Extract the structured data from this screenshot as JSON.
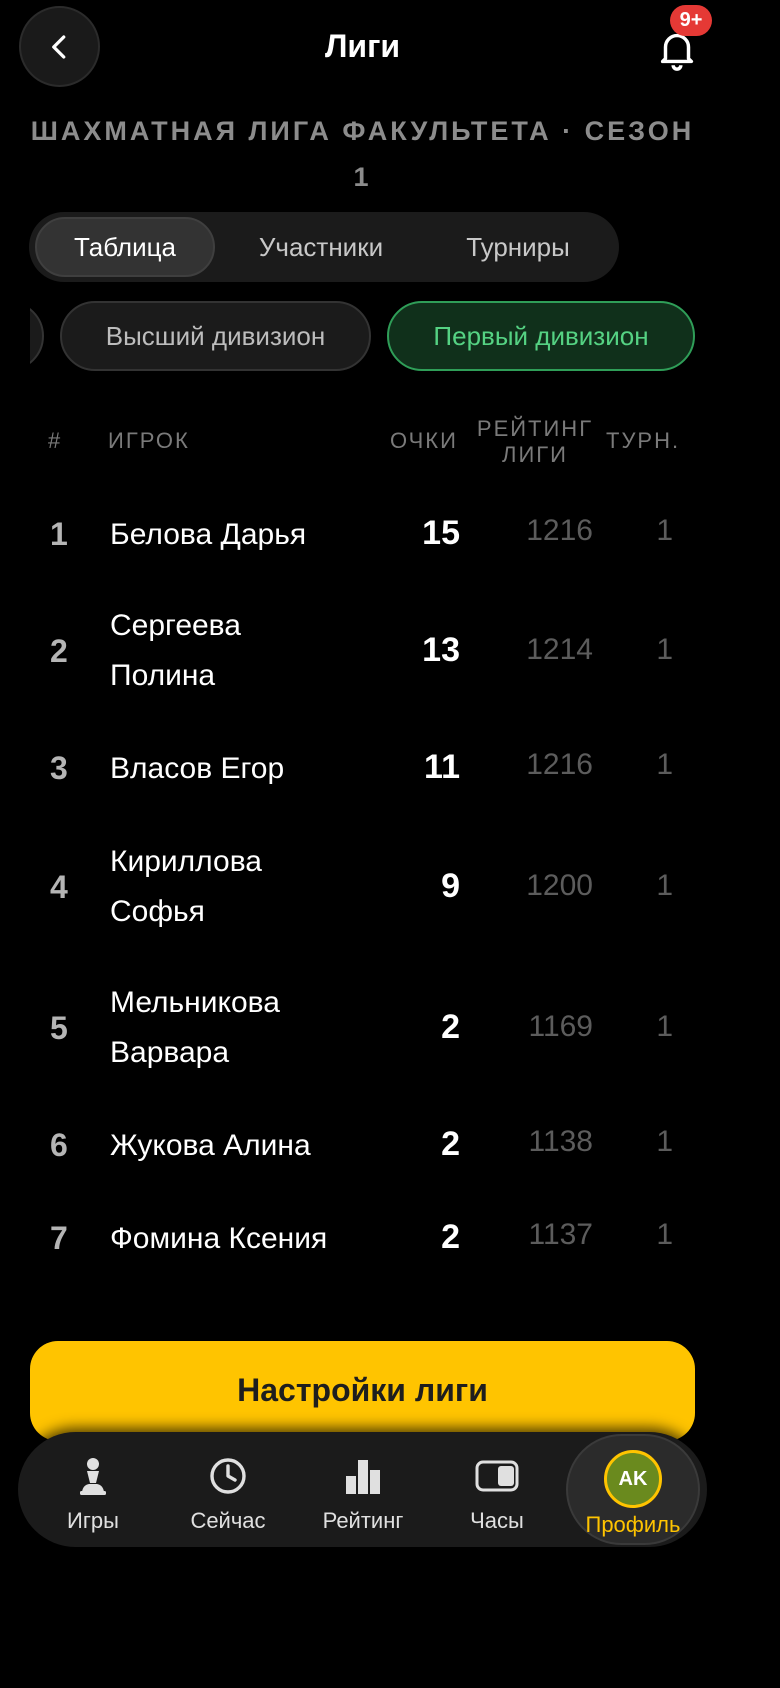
{
  "header": {
    "title": "Лиги",
    "notification_badge": "9+"
  },
  "league": {
    "title": "ШАХМАТНАЯ ЛИГА ФАКУЛЬТЕТА · СЕЗОН 1"
  },
  "tabs": [
    {
      "label": "Таблица",
      "active": true
    },
    {
      "label": "Участники",
      "active": false
    },
    {
      "label": "Турниры",
      "active": false
    }
  ],
  "divisions": [
    {
      "label": "",
      "selected": false
    },
    {
      "label": "Высший дивизион",
      "selected": false
    },
    {
      "label": "Первый дивизион",
      "selected": true
    }
  ],
  "table": {
    "headers": {
      "rank": "#",
      "player": "ИГРОК",
      "points": "ОЧКИ",
      "rating": "РЕЙТИНГ ЛИГИ",
      "tournaments": "ТУРН."
    },
    "rows": [
      {
        "rank": "1",
        "name": "Белова Дарья",
        "points": "15",
        "rating": "1216",
        "tournaments": "1"
      },
      {
        "rank": "2",
        "name": "Сергеева Полина",
        "points": "13",
        "rating": "1214",
        "tournaments": "1"
      },
      {
        "rank": "3",
        "name": "Власов Егор",
        "points": "11",
        "rating": "1216",
        "tournaments": "1"
      },
      {
        "rank": "4",
        "name": "Кириллова Софья",
        "points": "9",
        "rating": "1200",
        "tournaments": "1"
      },
      {
        "rank": "5",
        "name": "Мельникова Варвара",
        "points": "2",
        "rating": "1169",
        "tournaments": "1"
      },
      {
        "rank": "6",
        "name": "Жукова Алина",
        "points": "2",
        "rating": "1138",
        "tournaments": "1"
      },
      {
        "rank": "7",
        "name": "Фомина Ксения",
        "points": "2",
        "rating": "1137",
        "tournaments": "1"
      }
    ]
  },
  "actions": {
    "league_settings": "Настройки лиги"
  },
  "bottom_nav": [
    {
      "label": "Игры",
      "icon": "pawn-icon"
    },
    {
      "label": "Сейчас",
      "icon": "clock-icon"
    },
    {
      "label": "Рейтинг",
      "icon": "bar-chart-icon"
    },
    {
      "label": "Часы",
      "icon": "chess-clock-icon"
    },
    {
      "label": "Профиль",
      "icon": "avatar",
      "avatar_initials": "AK",
      "active": true
    }
  ],
  "colors": {
    "accent": "#ffc400",
    "selected_division": "#55d283",
    "badge": "#e53935"
  }
}
